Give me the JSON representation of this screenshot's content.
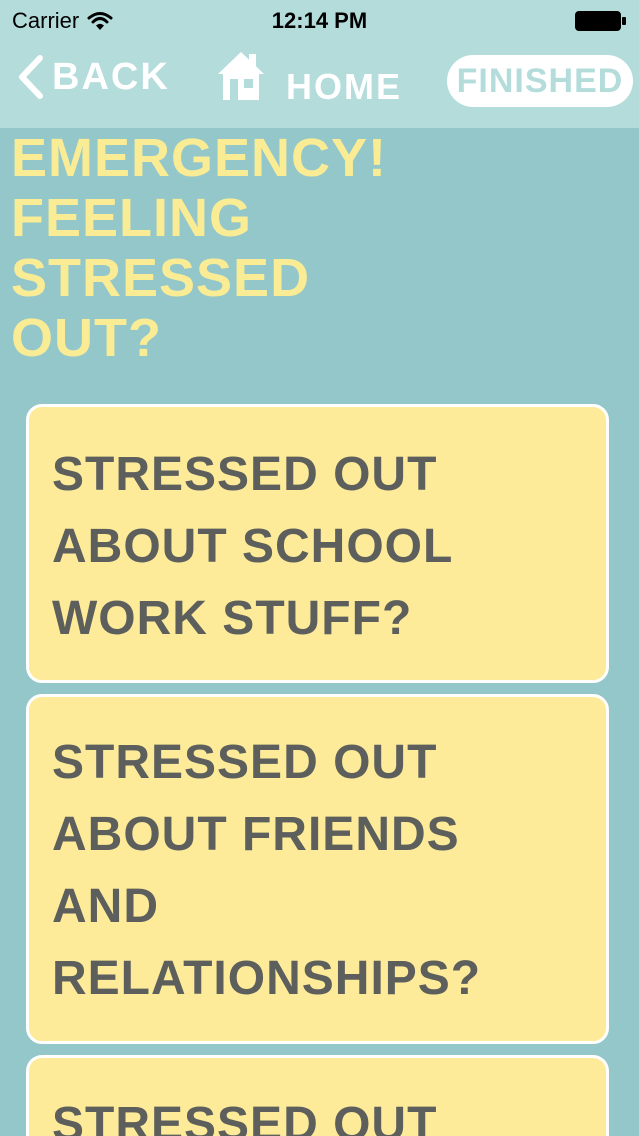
{
  "status_bar": {
    "carrier": "Carrier",
    "time": "12:14 PM",
    "icons": [
      "wifi-icon",
      "battery-icon"
    ]
  },
  "nav": {
    "back_label": "BACK",
    "home_label": "HOME",
    "finished_label": "FINISHED",
    "icons": [
      "chevron-left-icon",
      "home-icon"
    ]
  },
  "title_lines": [
    "EMERGENCY!",
    "FEELING",
    "STRESSED",
    "OUT?"
  ],
  "cards": [
    {
      "lines": [
        "STRESSED OUT",
        "ABOUT SCHOOL",
        "WORK STUFF?"
      ]
    },
    {
      "lines": [
        "STRESSED OUT",
        "ABOUT FRIENDS",
        "AND",
        "RELATIONSHIPS?"
      ]
    },
    {
      "lines": [
        "STRESSED OUT"
      ]
    }
  ],
  "colors": {
    "background": "#93c7c9",
    "header": "#b3dcdb",
    "title": "#faec95",
    "card": "#fdeb99",
    "card_text": "#5d5f5d",
    "white": "#ffffff"
  }
}
